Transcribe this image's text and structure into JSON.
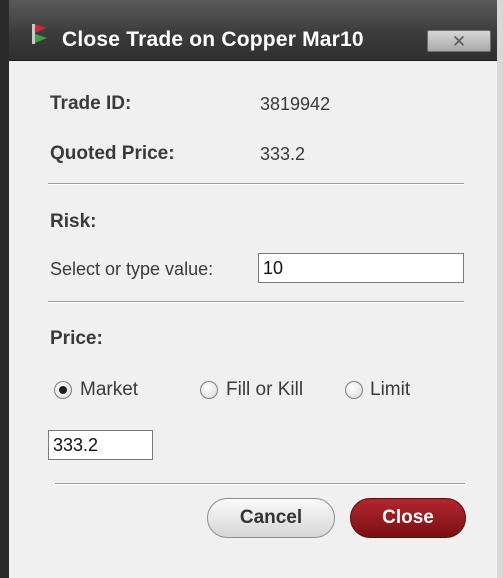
{
  "dialog": {
    "title": "Close Trade on Copper Mar10",
    "close_glyph": "✕"
  },
  "trade_info": {
    "trade_id_label": "Trade ID:",
    "trade_id_value": "3819942",
    "quoted_price_label": "Quoted Price:",
    "quoted_price_value": "333.2"
  },
  "risk": {
    "heading": "Risk:",
    "select_label": "Select or type value:",
    "value": "10"
  },
  "price": {
    "heading": "Price:",
    "options": [
      {
        "label": "Market",
        "selected": true
      },
      {
        "label": "Fill or Kill",
        "selected": false
      },
      {
        "label": "Limit",
        "selected": false
      }
    ],
    "value": "333.2"
  },
  "buttons": {
    "cancel_label": "Cancel",
    "close_label": "Close"
  },
  "icons": {
    "app": "flag-icon",
    "close": "close-icon"
  },
  "colors": {
    "title_bar": "#3c3c3c",
    "close_button": "#9c1b21",
    "icon_red": "#d4262b",
    "icon_green": "#3aa34a"
  }
}
